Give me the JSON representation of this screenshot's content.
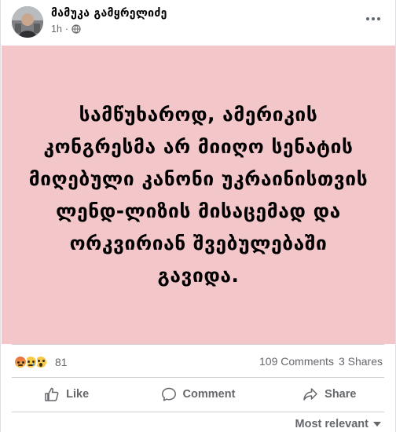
{
  "post": {
    "author": "მამუკა გამყრელიძე",
    "time": "1h",
    "privacy_icon": "globe-icon",
    "text": "სამწუხაროდ, ამერიკის კონგრესმა არ მიიღო სენატის მიღებული კანონი უკრაინისთვის ლენდ-ლიზის მისაცემად და ორკვირიან შვებულებაში გავიდა.",
    "background_color": "#f3c6c9"
  },
  "stats": {
    "reactions": [
      "angry-reaction-icon",
      "sad-reaction-icon",
      "wow-reaction-icon"
    ],
    "reaction_count": "81",
    "comments": "109 Comments",
    "shares": "3 Shares"
  },
  "actions": {
    "like": "Like",
    "comment": "Comment",
    "share": "Share"
  },
  "comments": {
    "sort_label": "Most relevant"
  }
}
